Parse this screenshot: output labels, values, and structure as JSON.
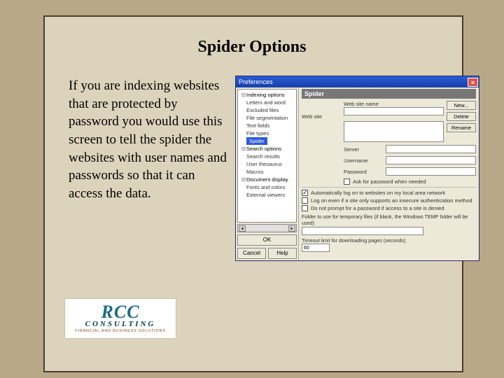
{
  "page_title": "Spider Options",
  "body_text": "If you are indexing websites that are protected by password you would use this screen to tell the spider the websites with user names and passwords so that it can access the data.",
  "dialog": {
    "title": "Preferences",
    "tree": {
      "root0": "Indexing options",
      "c0": "Letters and word",
      "c1": "Excluded files",
      "c2": "File segmentation",
      "c3": "Text fields",
      "c4": "File types",
      "c5_selected": "Spider",
      "root1": "Search options",
      "c6": "Search results",
      "c7": "User thesaurus",
      "c8": "Macros",
      "root2": "Document display",
      "c9": "Fonts and colors",
      "c10": "External viewers"
    },
    "left_buttons": {
      "ok": "OK",
      "cancel": "Cancel",
      "help": "Help"
    },
    "panel": {
      "header": "Spider",
      "label_website": "Web site",
      "label_website_name": "Web site name",
      "label_server": "Server",
      "label_username": "Username",
      "label_password": "Password",
      "btn_new": "New...",
      "btn_delete": "Delete",
      "btn_rename": "Rename",
      "chk_ask": "Ask for password when needed",
      "chk_auto": "Automatically log on to websites on my local area network",
      "chk_logon": "Log on even if a site only supports an insecure authentication method",
      "chk_noprompt": "Do not prompt for a password if access to a site is denied",
      "note_folder": "Folder to use for temporary files (if blank, the Windows TEMP folder will be used)",
      "label_timeout": "Timeout limit for downloading pages (seconds)",
      "timeout_value": "60"
    }
  },
  "logo": {
    "l1": "RCC",
    "l2": "CONSULTING",
    "l3": "FINANCIAL AND BUSINESS SOLUTIONS"
  }
}
